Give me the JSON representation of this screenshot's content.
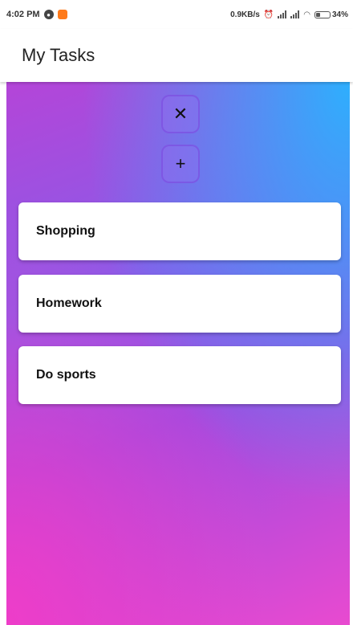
{
  "status_bar": {
    "time": "4:02 PM",
    "network_speed": "0.9KB/s",
    "battery_percent": "34%",
    "battery_level": 0.34
  },
  "app_bar": {
    "title": "My Tasks"
  },
  "actions": {
    "close_symbol": "✕",
    "add_symbol": "+"
  },
  "tasks": [
    {
      "label": "Shopping"
    },
    {
      "label": "Homework"
    },
    {
      "label": "Do sports"
    }
  ],
  "colors": {
    "gradient_top_right": "#28b4ff",
    "gradient_middle": "#8a5be8",
    "gradient_bottom_left": "#f03cc8",
    "card_background": "#ffffff"
  }
}
